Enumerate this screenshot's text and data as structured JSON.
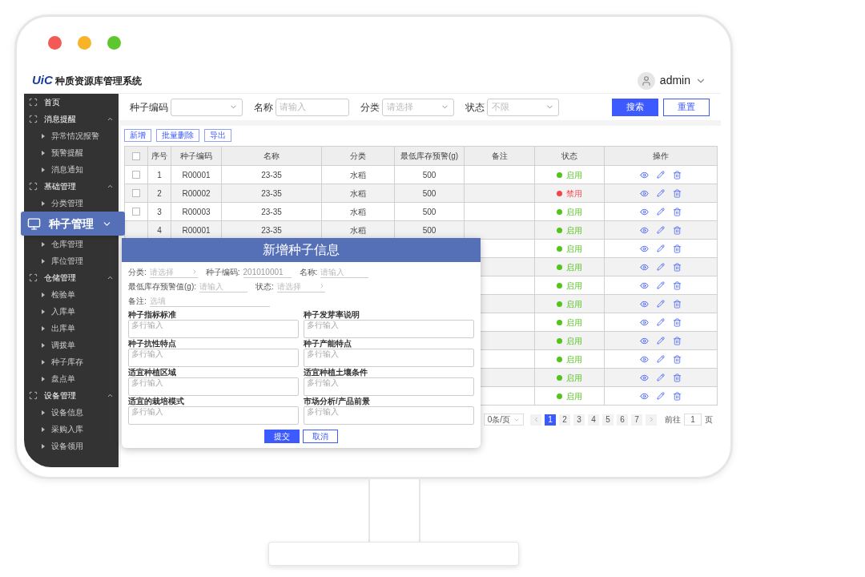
{
  "app": {
    "logo": "UiC",
    "title": "种质资源库管理系统",
    "user": "admin"
  },
  "sidebar": {
    "items": [
      {
        "label": "首页"
      },
      {
        "label": "消息提醒",
        "expanded": true,
        "children": [
          {
            "label": "异常情况报警",
            "selected": false
          },
          {
            "label": "预警提醒",
            "selected": false
          },
          {
            "label": "消息通知",
            "selected": false
          }
        ]
      },
      {
        "label": "基础管理",
        "expanded": true,
        "children": [
          {
            "label": "分类管理",
            "selected": false
          },
          {
            "label": "种子管理",
            "selected": true
          },
          {
            "label": "仓库管理",
            "selected": false
          },
          {
            "label": "库位管理",
            "selected": false
          }
        ]
      },
      {
        "label": "仓储管理",
        "expanded": true,
        "children": [
          {
            "label": "检验单",
            "selected": false
          },
          {
            "label": "入库单",
            "selected": false
          },
          {
            "label": "出库单",
            "selected": false
          },
          {
            "label": "调拨单",
            "selected": false
          },
          {
            "label": "种子库存",
            "selected": false
          },
          {
            "label": "盘点单",
            "selected": false
          }
        ]
      },
      {
        "label": "设备管理",
        "expanded": true,
        "children": [
          {
            "label": "设备信息",
            "selected": false
          },
          {
            "label": "采购入库",
            "selected": false
          },
          {
            "label": "设备领用",
            "selected": false
          }
        ]
      }
    ]
  },
  "filters": [
    {
      "label": "种子编码",
      "kind": "select"
    },
    {
      "label": "名称",
      "kind": "input",
      "placeholder": "请输入"
    },
    {
      "label": "分类",
      "kind": "select",
      "placeholder": "请选择"
    },
    {
      "label": "状态",
      "kind": "select",
      "placeholder": "不限"
    }
  ],
  "filter_buttons": [
    {
      "label": "搜索",
      "kind": "primary"
    },
    {
      "label": "重置",
      "kind": "outline"
    }
  ],
  "toolbar": [
    "新增",
    "批量删除",
    "导出"
  ],
  "table": {
    "header_checkbox": {
      "checked": false
    },
    "columns": [
      "序号",
      "种子编码",
      "名称",
      "分类",
      "最低库存预警(g)",
      "备注",
      "状态",
      "操作"
    ],
    "rows": [
      {
        "checked": false,
        "index": "1",
        "code": "R00001",
        "name": "23-35",
        "category": "水稻",
        "min_stock": "500",
        "status": "启用",
        "enabled": true
      },
      {
        "checked": false,
        "index": "2",
        "code": "R00002",
        "name": "23-35",
        "category": "水稻",
        "min_stock": "500",
        "status": "禁用",
        "enabled": false
      },
      {
        "checked": false,
        "index": "3",
        "code": "R00003",
        "name": "23-35",
        "category": "水稻",
        "min_stock": "500",
        "status": "启用",
        "enabled": true
      },
      {
        "index": "4",
        "code": "R00001",
        "name": "23-35",
        "category": "水稻",
        "min_stock": "500",
        "status": "启用",
        "enabled": true
      },
      {
        "status": "启用",
        "enabled": true
      },
      {
        "status": "启用",
        "enabled": true
      },
      {
        "status": "启用",
        "enabled": true
      },
      {
        "status": "启用",
        "enabled": true
      },
      {
        "status": "启用",
        "enabled": true
      },
      {
        "status": "启用",
        "enabled": true
      },
      {
        "status": "启用",
        "enabled": true
      },
      {
        "status": "启用",
        "enabled": true
      },
      {
        "status": "启用",
        "enabled": true
      }
    ]
  },
  "pagination": {
    "page_size": "0条/页",
    "pages": [
      {
        "label": "1",
        "selected": true
      },
      {
        "label": "2",
        "selected": false
      },
      {
        "label": "3",
        "selected": false
      },
      {
        "label": "4",
        "selected": false
      },
      {
        "label": "5",
        "selected": false
      },
      {
        "label": "6",
        "selected": false
      },
      {
        "label": "7",
        "selected": false
      }
    ],
    "goto_label": "前往",
    "goto_value": "1",
    "page_unit": "页"
  },
  "modal": {
    "title": "新增种子信息",
    "fields": [
      {
        "label": "分类:",
        "kind": "select",
        "placeholder": "请选择"
      },
      {
        "label": "种子编码:",
        "kind": "input",
        "value": "201010001"
      },
      {
        "label": "名称:",
        "kind": "input",
        "placeholder": "请输入"
      },
      {
        "label": "最低库存预警值(g):",
        "kind": "input",
        "placeholder": "请输入"
      },
      {
        "label": "状态:",
        "kind": "select",
        "placeholder": "请选择"
      },
      {
        "label": "备注:",
        "kind": "wide",
        "placeholder": "选填"
      }
    ],
    "textareas": [
      {
        "label": "种子指标标准",
        "placeholder": "多行输入"
      },
      {
        "label": "种子发芽率说明",
        "placeholder": "多行输入"
      },
      {
        "label": "种子抗性特点",
        "placeholder": "多行输入"
      },
      {
        "label": "种子产能特点",
        "placeholder": "多行输入"
      },
      {
        "label": "适宜种植区域",
        "placeholder": "多行输入"
      },
      {
        "label": "适宜种植土壤条件",
        "placeholder": "多行输入"
      },
      {
        "label": "适宜的栽培模式",
        "placeholder": "多行输入"
      },
      {
        "label": "市场分析/产品前景",
        "placeholder": "多行输入"
      }
    ],
    "buttons": [
      {
        "label": "提交",
        "kind": "primary"
      },
      {
        "label": "取消",
        "kind": "outline"
      }
    ]
  }
}
